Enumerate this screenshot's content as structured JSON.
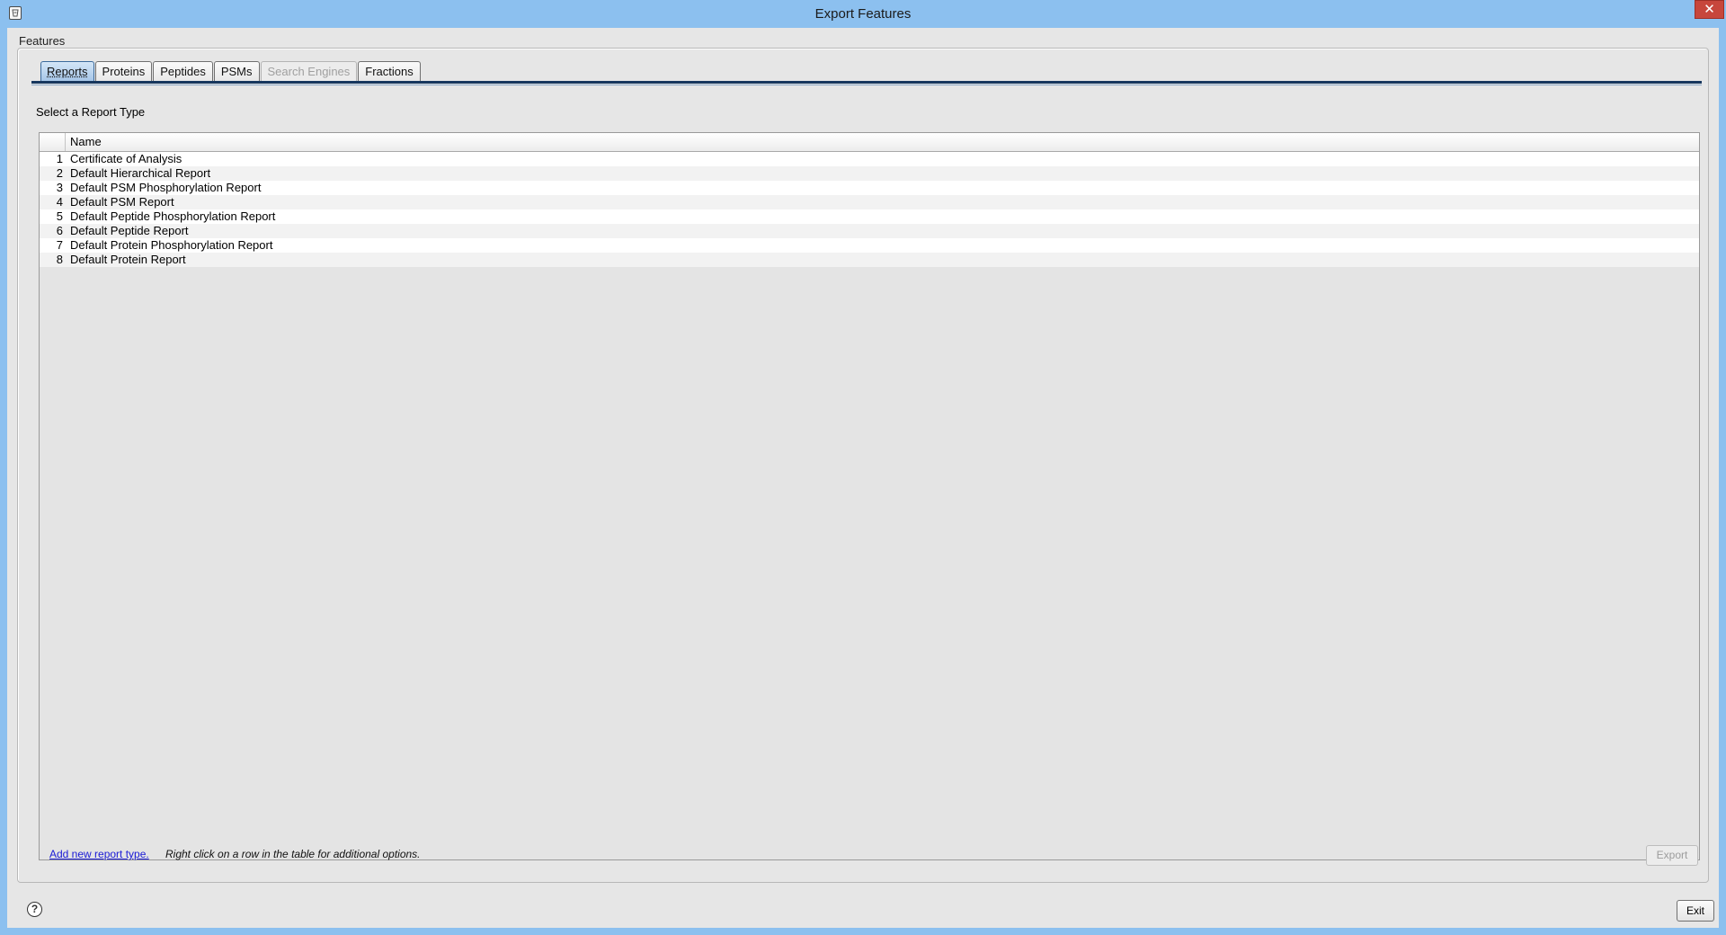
{
  "window": {
    "title": "Export Features",
    "close_glyph": "✕",
    "app_icon": "app-icon"
  },
  "features": {
    "label": "Features"
  },
  "tabs": [
    {
      "label": "Reports",
      "state": "active"
    },
    {
      "label": "Proteins",
      "state": "normal"
    },
    {
      "label": "Peptides",
      "state": "normal"
    },
    {
      "label": "PSMs",
      "state": "normal"
    },
    {
      "label": "Search Engines",
      "state": "disabled"
    },
    {
      "label": "Fractions",
      "state": "normal"
    }
  ],
  "reports": {
    "section_label": "Select a Report Type",
    "columns": [
      "",
      "Name"
    ],
    "rows": [
      {
        "index": "1",
        "name": "Certificate of Analysis"
      },
      {
        "index": "2",
        "name": "Default Hierarchical Report"
      },
      {
        "index": "3",
        "name": "Default PSM Phosphorylation Report"
      },
      {
        "index": "4",
        "name": "Default PSM Report"
      },
      {
        "index": "5",
        "name": "Default Peptide Phosphorylation Report"
      },
      {
        "index": "6",
        "name": "Default Peptide Report"
      },
      {
        "index": "7",
        "name": "Default Protein Phosphorylation Report"
      },
      {
        "index": "8",
        "name": "Default Protein Report"
      }
    ],
    "add_link": "Add new report type.",
    "hint": "Right click on a row in the table for additional options.",
    "export_label": "Export"
  },
  "footer": {
    "help_glyph": "?",
    "exit_label": "Exit"
  },
  "colors": {
    "titlebar": "#8cc0ef",
    "close": "#c7463c",
    "tab_active": "#a6c6e8",
    "link": "#1a1ad6"
  }
}
